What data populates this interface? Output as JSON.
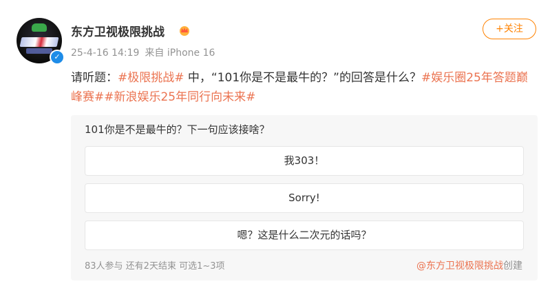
{
  "user": {
    "name": "东方卫视极限挑战",
    "badge_icon": "crown-badge-icon",
    "verified_icon": "verified-check-icon"
  },
  "post": {
    "time": "25-4-16 14:19",
    "source": "来自 iPhone 16",
    "follow_label": "+关注",
    "text_prefix": "请听题：",
    "topic_1": "#极限挑战#",
    "text_middle": " 中，“101你是不是最牛的？”的回答是什么？",
    "topic_2": "#娱乐圈25年答题巅峰赛#",
    "topic_3": "#新浪娱乐25年同行向未来#"
  },
  "poll": {
    "question": "101你是不是最牛的？下一句应该接啥？",
    "options": [
      {
        "label": "我303！"
      },
      {
        "label": "Sorry!"
      },
      {
        "label": "嗯？这是什么二次元的话吗？"
      }
    ],
    "stats": "83人参与 还有2天结束 可选1~3项",
    "creator_mention": "@东方卫视极限挑战",
    "creator_suffix": "创建"
  },
  "colors": {
    "accent": "#ff8200",
    "topic": "#eb7350",
    "muted": "#939393"
  }
}
